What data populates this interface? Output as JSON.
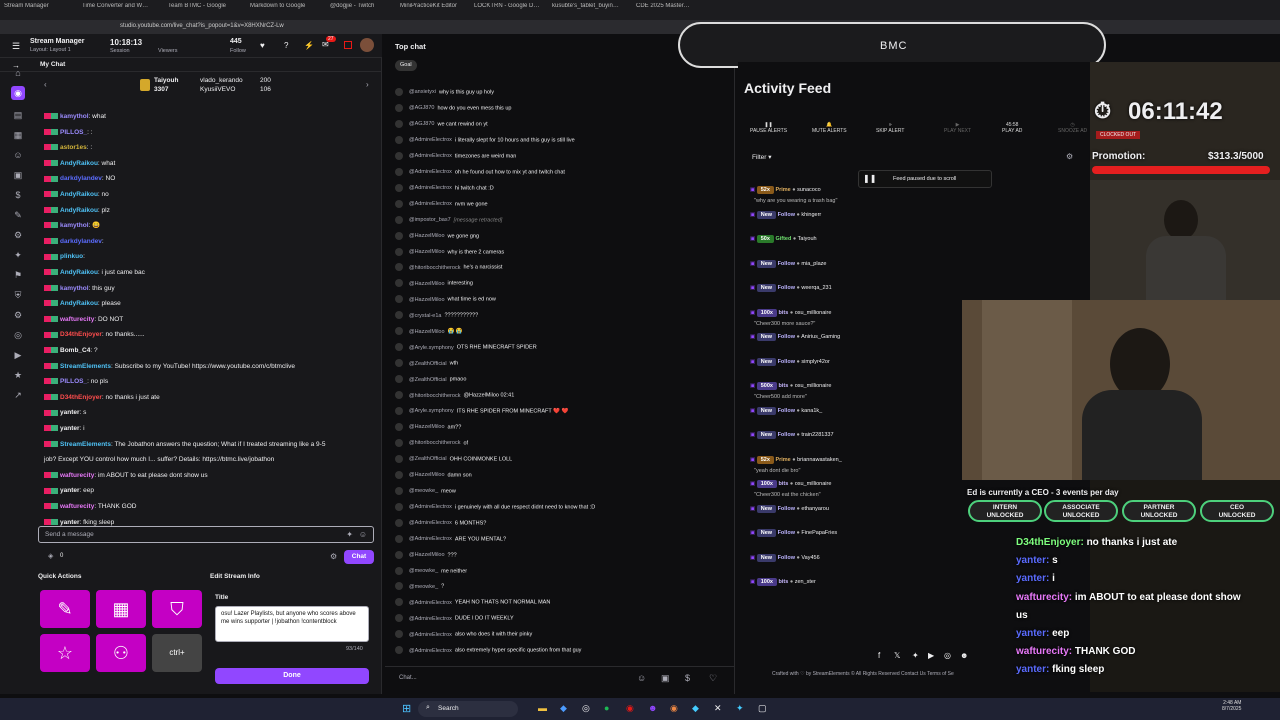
{
  "browser": {
    "tabs": [
      "Stream Manager",
      "Time Converter and W…",
      "Team BTMC - Google",
      "Markdown to Google",
      "@dogjie - Twitch",
      "MiniPracticeKit Editor",
      "LOCKTRN - Google D…",
      "kusubte's_tablet_buyin…",
      "CDE 2025 Master…"
    ],
    "url": "studio.youtube.com/live_chat?is_popout=1&v=X8HXNrCZ-Lw"
  },
  "header": {
    "title": "Stream Manager",
    "layout": "Layout: Layout 1",
    "session_time": "10:18:13",
    "session_label": "Session",
    "viewers_label": "Viewers",
    "follows": "445",
    "follows_label": "Follow",
    "notif_count": "27"
  },
  "my_chat": {
    "label": "My Chat",
    "pinned": [
      {
        "name": "Taiyouh",
        "value": "3307"
      },
      {
        "name": "vlado_kerando",
        "value": "200"
      },
      {
        "name": "KyusiiVEVO",
        "value": "106"
      }
    ]
  },
  "chat": [
    {
      "user": "kamythol",
      "color": "#9c8cff",
      "text": "what"
    },
    {
      "user": "PILLOS_",
      "color": "#9c8cff",
      "text": ":"
    },
    {
      "user": "astor1es",
      "color": "#d4b53a",
      "text": ":"
    },
    {
      "user": "AndyRaikou",
      "color": "#4fc3f7",
      "text": "what"
    },
    {
      "user": "darkdylandev",
      "color": "#5b6cff",
      "text": "NO"
    },
    {
      "user": "AndyRaikou",
      "color": "#4fc3f7",
      "text": "no"
    },
    {
      "user": "AndyRaikou",
      "color": "#4fc3f7",
      "text": "plz"
    },
    {
      "user": "kamythol",
      "color": "#9c8cff",
      "text": "😀"
    },
    {
      "user": "darkdylandev",
      "color": "#5b6cff",
      "text": ""
    },
    {
      "user": "plinkuo",
      "color": "#4fc3f7",
      "text": ""
    },
    {
      "user": "AndyRaikou",
      "color": "#4fc3f7",
      "text": "i just came bac"
    },
    {
      "user": "kamythol",
      "color": "#9c8cff",
      "text": "this guy"
    },
    {
      "user": "AndyRaikou",
      "color": "#4fc3f7",
      "text": "please"
    },
    {
      "user": "wafturecity",
      "color": "#e879f9",
      "text": "DO NOT"
    },
    {
      "user": "D34thEnjoyer",
      "color": "#ff4d4d",
      "text": "no thanks......"
    },
    {
      "user": "Bomb_C4",
      "color": "#efeff1",
      "text": "?"
    },
    {
      "user": "StreamElements",
      "color": "#4fc3f7",
      "text": "Subscribe to my YouTube! https://www.youtube.com/c/btmclive"
    },
    {
      "user": "PILLOS_",
      "color": "#9c8cff",
      "text": "no pls"
    },
    {
      "user": "D34thEnjoyer",
      "color": "#ff4d4d",
      "text": "no thanks i just ate"
    },
    {
      "user": "yanter",
      "color": "#efeff1",
      "text": "s"
    },
    {
      "user": "yanter",
      "color": "#efeff1",
      "text": "i"
    },
    {
      "user": "StreamElements",
      "color": "#4fc3f7",
      "text": "The Jobathon answers the question; What if I treated streaming like a 9-5"
    },
    {
      "user": "",
      "color": "#efeff1",
      "text": "job? Except YOU control how much I... suffer? Details: https://btmc.live/jobathon"
    },
    {
      "user": "wafturecity",
      "color": "#e879f9",
      "text": "im ABOUT to eat please dont show us"
    },
    {
      "user": "yanter",
      "color": "#efeff1",
      "text": "eep"
    },
    {
      "user": "wafturecity",
      "color": "#e879f9",
      "text": "THANK GOD"
    },
    {
      "user": "yanter",
      "color": "#efeff1",
      "text": "fking sleep"
    }
  ],
  "chat_input": {
    "placeholder": "Send a message",
    "chat_btn": "Chat",
    "points": "0"
  },
  "quick_actions": {
    "label": "Quick Actions"
  },
  "edit_stream": {
    "label": "Edit Stream Info",
    "title_label": "Title",
    "title_value": "osu! Lazer Playlists, but anyone who scores above me wins supporter | !jobathon !contentblock",
    "char_count": "93/140",
    "done": "Done"
  },
  "top_chat": {
    "label": "Top chat",
    "goal": "Goal",
    "input_placeholder": "Chat...",
    "lines": [
      {
        "n": "@anxietyxi",
        "t": "why is this guy up holy"
      },
      {
        "n": "@AGJ870",
        "t": "how do you even mess this up"
      },
      {
        "n": "@AGJ870",
        "t": "we cant rewind on yt"
      },
      {
        "n": "@AdmireElectrox",
        "t": "i literally slept for 10 hours and this guy is still live"
      },
      {
        "n": "@AdmireElectrox",
        "t": "timezones are weird man"
      },
      {
        "n": "@AdmireElectrox",
        "t": "oh he found out how to mix yt and twitch chat"
      },
      {
        "n": "@AdmireElectrox",
        "t": "hi twitch chat :D"
      },
      {
        "n": "@AdmireElectrox",
        "t": "nvm we gone"
      },
      {
        "n": "@impostor_bas7",
        "t": "[message retracted]"
      },
      {
        "n": "@HazzelMiloo",
        "t": "we gone gng"
      },
      {
        "n": "@HazzelMiloo",
        "t": "why is there 2 cameras"
      },
      {
        "n": "@hitoribocchitherock",
        "t": "he's a narcissist"
      },
      {
        "n": "@HazzelMiloo",
        "t": "interesting"
      },
      {
        "n": "@HazzelMiloo",
        "t": "what time is ed now"
      },
      {
        "n": "@crystal-e1a",
        "t": "???????????"
      },
      {
        "n": "@HazzelMiloo",
        "t": "😭 😭"
      },
      {
        "n": "@Aryle.symphony",
        "t": "OTS RHE MINECRAFT SPIDER"
      },
      {
        "n": "@ZealthOfficial",
        "t": "wth"
      },
      {
        "n": "@ZealthOfficial",
        "t": "pmaoo"
      },
      {
        "n": "@hitoribocchitherock",
        "t": "@HazzelMiloo 02:41"
      },
      {
        "n": "@Aryle.symphony",
        "t": "ITS RHE SPIDER FROM MINECRAFT ❤️ ❤️"
      },
      {
        "n": "@HazzelMiloo",
        "t": "am??"
      },
      {
        "n": "@hitoribocchitherock",
        "t": "of"
      },
      {
        "n": "@ZealthOfficial",
        "t": "OHH COINMONKE LOLL"
      },
      {
        "n": "@HazzelMiloo",
        "t": "damn son"
      },
      {
        "n": "@meowke_",
        "t": "meow"
      },
      {
        "n": "@AdmireElectrox",
        "t": "i genuinely with all due respect didnt need to know that :D"
      },
      {
        "n": "@AdmireElectrox",
        "t": "6 MONTHS?"
      },
      {
        "n": "@AdmireElectrox",
        "t": "ARE YOU MENTAL?"
      },
      {
        "n": "@HazzelMiloo",
        "t": "???"
      },
      {
        "n": "@meowke_",
        "t": "me neither"
      },
      {
        "n": "@meowke_",
        "t": "?"
      },
      {
        "n": "@AdmireElectrox",
        "t": "YEAH NO THATS NOT NORMAL MAN"
      },
      {
        "n": "@AdmireElectrox",
        "t": "DUDE I DO IT WEEKLY"
      },
      {
        "n": "@AdmireElectrox",
        "t": "also who does it with their pinky"
      },
      {
        "n": "@AdmireElectrox",
        "t": "also extremely hyper specific question from that guy"
      }
    ]
  },
  "bmc": {
    "label": "BMC"
  },
  "activity": {
    "title": "Activity Feed",
    "controls": [
      "PAUSE ALERTS",
      "MUTE ALERTS",
      "SKIP ALERT",
      "PLAY NEXT",
      "PLAY AD",
      "SNOOZE AD"
    ],
    "ad_time": "45:58",
    "filter": "Filter",
    "paused_msg": "Feed paused due to scroll",
    "items": [
      {
        "tag": "52x",
        "kind": "Prime",
        "name": "sunacoco",
        "msg": "\"why are you wearing a trash bag\""
      },
      {
        "tag": "New",
        "kind": "Follow",
        "name": "khingerr",
        "msg": ""
      },
      {
        "tag": "50x",
        "kind": "Gifted",
        "name": "Taiyouh",
        "msg": ""
      },
      {
        "tag": "New",
        "kind": "Follow",
        "name": "mia_plaze",
        "msg": ""
      },
      {
        "tag": "New",
        "kind": "Follow",
        "name": "weerqa_231",
        "msg": ""
      },
      {
        "tag": "100x",
        "kind": "bits",
        "name": "osu_millionaire",
        "msg": "\"Cheer300 more sauce?\""
      },
      {
        "tag": "New",
        "kind": "Follow",
        "name": "Anirius_Gaming",
        "msg": ""
      },
      {
        "tag": "New",
        "kind": "Follow",
        "name": "simplyr42or",
        "msg": ""
      },
      {
        "tag": "500x",
        "kind": "bits",
        "name": "osu_millionaire",
        "msg": "\"Cheer500 add more\""
      },
      {
        "tag": "New",
        "kind": "Follow",
        "name": "kana1k_",
        "msg": ""
      },
      {
        "tag": "New",
        "kind": "Follow",
        "name": "train2281337",
        "msg": ""
      },
      {
        "tag": "52x",
        "kind": "Prime",
        "name": "briannawastaken_",
        "msg": "\"yeah dont die bro\""
      },
      {
        "tag": "100x",
        "kind": "bits",
        "name": "osu_millionaire",
        "msg": "\"Cheer300 eat the chicken\""
      },
      {
        "tag": "New",
        "kind": "Follow",
        "name": "ethanyarou",
        "msg": ""
      },
      {
        "tag": "New",
        "kind": "Follow",
        "name": "FinePapaFries",
        "msg": ""
      },
      {
        "tag": "New",
        "kind": "Follow",
        "name": "Vay456",
        "msg": ""
      },
      {
        "tag": "100x",
        "kind": "bits",
        "name": "zen_ster",
        "msg": ""
      }
    ],
    "footer": "Crafted with ♡ by StreamElements © All Rights Reserved Contact Us Terms of Se"
  },
  "stream": {
    "timer": "06:11:42",
    "clocked": "CLOCKED OUT",
    "promotion_label": "Promotion:",
    "promotion_value": "$313.3/5000",
    "ceo_text": "Ed is currently a CEO - 3 events per day",
    "ranks": [
      {
        "name": "INTERN",
        "state": "UNLOCKED"
      },
      {
        "name": "ASSOCIATE",
        "state": "UNLOCKED"
      },
      {
        "name": "PARTNER",
        "state": "UNLOCKED"
      },
      {
        "name": "CEO",
        "state": "UNLOCKED"
      }
    ],
    "overlay_chat": [
      {
        "u": "D34thEnjoyer",
        "c": "#7fff7f",
        "t": "no thanks i just ate"
      },
      {
        "u": "yanter",
        "c": "#5b6cff",
        "t": "s"
      },
      {
        "u": "yanter",
        "c": "#5b6cff",
        "t": "i"
      },
      {
        "u": "wafturecity",
        "c": "#e879f9",
        "t": "im ABOUT to eat please dont show"
      },
      {
        "u": "",
        "c": "#fff",
        "t": "us"
      },
      {
        "u": "yanter",
        "c": "#5b6cff",
        "t": "eep"
      },
      {
        "u": "wafturecity",
        "c": "#e879f9",
        "t": "THANK GOD"
      },
      {
        "u": "yanter",
        "c": "#5b6cff",
        "t": "fking sleep"
      }
    ]
  },
  "taskbar": {
    "search": "Search",
    "time": "2:48 AM",
    "date": "8/7/2025"
  }
}
